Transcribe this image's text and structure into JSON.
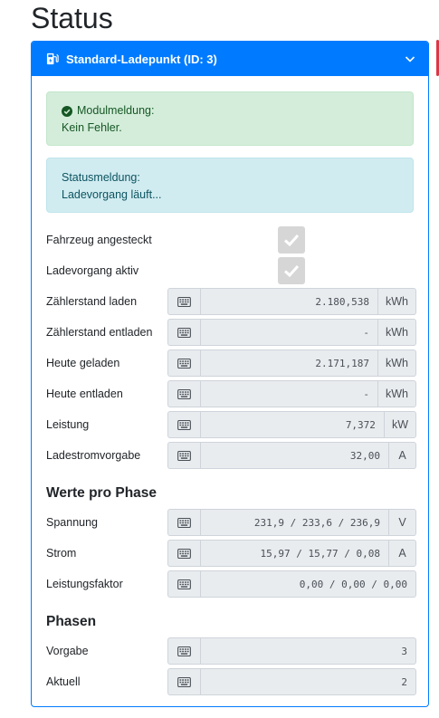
{
  "page": {
    "title": "Status"
  },
  "card": {
    "header_title": "Standard-Ladepunkt (ID: 3)"
  },
  "alerts": {
    "module": {
      "title": "Modulmeldung:",
      "text": "Kein Fehler."
    },
    "status": {
      "title": "Statusmeldung:",
      "text": "Ladevorgang läuft..."
    }
  },
  "flags": [
    {
      "label": "Fahrzeug angesteckt",
      "checked": true
    },
    {
      "label": "Ladevorgang aktiv",
      "checked": true
    }
  ],
  "values": [
    {
      "label": "Zählerstand laden",
      "value": "2.180,538",
      "unit": "kWh"
    },
    {
      "label": "Zählerstand entladen",
      "value": "-",
      "unit": "kWh"
    },
    {
      "label": "Heute geladen",
      "value": "2.171,187",
      "unit": "kWh"
    },
    {
      "label": "Heute entladen",
      "value": "-",
      "unit": "kWh"
    },
    {
      "label": "Leistung",
      "value": "7,372",
      "unit": "kW"
    },
    {
      "label": "Ladestromvorgabe",
      "value": "32,00",
      "unit": "A"
    }
  ],
  "phase_section": {
    "title": "Werte pro Phase",
    "rows": [
      {
        "label": "Spannung",
        "value": "231,9 / 233,6 / 236,9",
        "unit": "V"
      },
      {
        "label": "Strom",
        "value": "15,97 / 15,77 / 0,08",
        "unit": "A"
      },
      {
        "label": "Leistungsfaktor",
        "value": "0,00 / 0,00 / 0,00",
        "unit": ""
      }
    ]
  },
  "phases": {
    "title": "Phasen",
    "rows": [
      {
        "label": "Vorgabe",
        "value": "3"
      },
      {
        "label": "Aktuell",
        "value": "2"
      }
    ]
  },
  "colors": {
    "primary": "#007bff",
    "success_bg": "#d4edda",
    "info_bg": "#d1ecf1",
    "accent_red": "#dc3545"
  },
  "icons": {
    "header": "charging-station-icon",
    "collapse": "chevron-down-icon",
    "success": "check-circle-icon",
    "input_addon": "keyboard-icon",
    "checkbox": "checkmark-icon"
  }
}
